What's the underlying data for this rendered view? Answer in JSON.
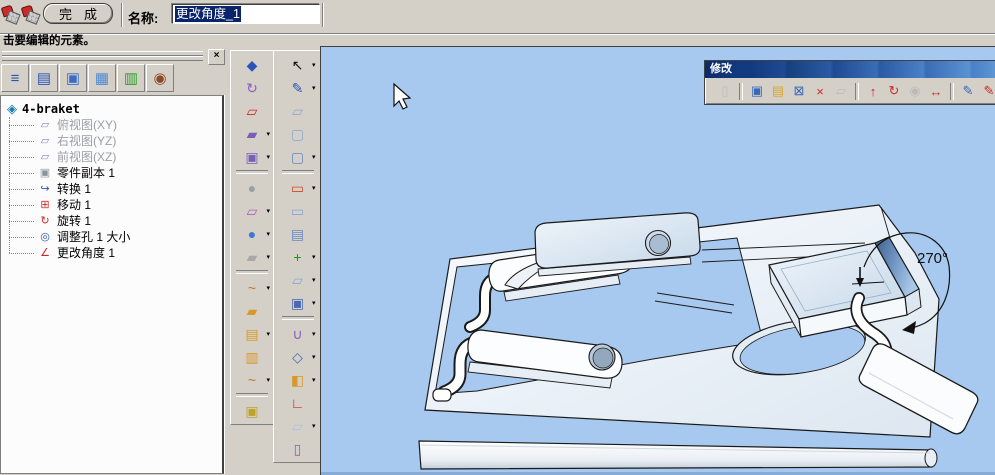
{
  "ui": {
    "dropdown_glyph": "▾",
    "window_bg": "#d4d0c8",
    "viewport_bg": "#a7c9ef",
    "selection_color": "#0a246a",
    "titlebar_blue": "#0a2a6a"
  },
  "top_toolbar": {
    "hammer_icons": [
      {
        "name": "hammer-tool-icon"
      },
      {
        "name": "hammer-tool-alt-icon"
      }
    ],
    "finish_label": "完成",
    "name_label": "名称:",
    "name_value": "更改角度_1"
  },
  "status_bar": {
    "text": "击要编辑的元素。"
  },
  "scene_browser": {
    "close_glyph": "×",
    "toolbar_icons": [
      {
        "name": "design-tree-icon",
        "glyph": "≡",
        "color": "#2a55b8"
      },
      {
        "name": "catalog-books-icon",
        "glyph": "▤",
        "color": "#2a55b8"
      },
      {
        "name": "assembly-parts-icon",
        "glyph": "▣",
        "color": "#3a6cc4"
      },
      {
        "name": "layers-icon",
        "glyph": "▦",
        "color": "#4a8ad4"
      },
      {
        "name": "render-settings-icon",
        "glyph": "▥",
        "color": "#2aa02a"
      },
      {
        "name": "camera-view-icon",
        "glyph": "◉",
        "color": "#8a4a2a"
      }
    ],
    "tree": {
      "root": {
        "label": "4-braket",
        "icon_name": "part-root-icon",
        "icon_glyph": "◈",
        "icon_color": "#1a7ab0"
      },
      "items": [
        {
          "label": "俯视图(XY)",
          "gray": true,
          "icon_name": "view-plane-icon",
          "icon_glyph": "▱",
          "icon_color": "#7a8fc0"
        },
        {
          "label": "右视图(YZ)",
          "gray": true,
          "icon_name": "view-plane-icon",
          "icon_glyph": "▱",
          "icon_color": "#7a8fc0"
        },
        {
          "label": "前视图(XZ)",
          "gray": true,
          "icon_name": "view-plane-icon",
          "icon_glyph": "▱",
          "icon_color": "#7a8fc0"
        },
        {
          "label": "零件副本 1",
          "gray": false,
          "icon_name": "part-copy-icon",
          "icon_glyph": "▣",
          "icon_color": "#8a94a0"
        },
        {
          "label": "转换 1",
          "gray": false,
          "icon_name": "transform-icon",
          "icon_glyph": "↪",
          "icon_color": "#2a55b8"
        },
        {
          "label": "移动 1",
          "gray": false,
          "icon_name": "move-icon",
          "icon_glyph": "⊞",
          "icon_color": "#cc2a2a"
        },
        {
          "label": "旋转 1",
          "gray": false,
          "icon_name": "rotate-icon",
          "icon_glyph": "↻",
          "icon_color": "#cc2a2a"
        },
        {
          "label": "调整孔 1 大小",
          "gray": false,
          "icon_name": "resize-hole-icon",
          "icon_glyph": "◎",
          "icon_color": "#2a55b8"
        },
        {
          "label": "更改角度 1",
          "gray": false,
          "icon_name": "change-angle-icon",
          "icon_glyph": "∠",
          "icon_color": "#cc2a2a"
        }
      ]
    }
  },
  "tool_columns": {
    "col1": [
      {
        "name": "smart-render-icon",
        "glyph": "◆",
        "color": "#2a55b8"
      },
      {
        "name": "spiral-tool-icon",
        "glyph": "↻",
        "color": "#8a5fc0"
      },
      {
        "name": "red-plane-icon",
        "glyph": "▱",
        "color": "#cc2a2a"
      },
      {
        "name": "surface-tool-icon",
        "glyph": "▰",
        "color": "#7a5fb8",
        "dd": true
      },
      {
        "name": "surface-copy-icon",
        "glyph": "▣",
        "color": "#7a5fb8",
        "dd": true
      },
      {
        "sep": true
      },
      {
        "name": "sphere-tool-icon",
        "glyph": "●",
        "color": "#9aa0a8"
      },
      {
        "name": "section-plane-icon",
        "glyph": "▱",
        "color": "#b05fb0",
        "dd": true
      },
      {
        "name": "blue-sphere-icon",
        "glyph": "●",
        "color": "#3a7ad4",
        "dd": true
      },
      {
        "name": "gray-surface-icon",
        "glyph": "▰",
        "color": "#a8a8a8",
        "dd": true
      },
      {
        "sep": true
      },
      {
        "name": "curve-tool-icon",
        "glyph": "~",
        "color": "#c07a2a",
        "dd": true
      },
      {
        "name": "gold-surface-icon",
        "glyph": "▰",
        "color": "#d9982a"
      },
      {
        "name": "fold-surface-icon",
        "glyph": "▤",
        "color": "#d9982a",
        "dd": true
      },
      {
        "name": "bend-surface-icon",
        "glyph": "▥",
        "color": "#d9982a"
      },
      {
        "name": "curve-point-icon",
        "glyph": "~",
        "color": "#c07a2a",
        "dd": true
      },
      {
        "sep": true
      },
      {
        "name": "camera-part-icon",
        "glyph": "▣",
        "color": "#c0a22a"
      }
    ],
    "col2": [
      {
        "name": "select-cursor-icon",
        "glyph": "↖",
        "color": "#111111",
        "dd": true
      },
      {
        "name": "edit-sketch-icon",
        "glyph": "✎",
        "color": "#2a55b8",
        "dd": true
      },
      {
        "name": "plane-icon",
        "glyph": "▱",
        "color": "#8aa8d4"
      },
      {
        "name": "bend-shape-icon",
        "glyph": "▢",
        "color": "#8aa8d4"
      },
      {
        "name": "bend-shape-alt-icon",
        "glyph": "▢",
        "color": "#6a88c0",
        "dd": true
      },
      {
        "sep": true
      },
      {
        "name": "profile-sketch-icon",
        "glyph": "▭",
        "color": "#cc4a2a",
        "dd": true
      },
      {
        "name": "blank-plane-icon",
        "glyph": "▭",
        "color": "#8aa8d4"
      },
      {
        "name": "extrude-shape-icon",
        "glyph": "▤",
        "color": "#6a88c0"
      },
      {
        "name": "add-material-icon",
        "glyph": "+",
        "color": "#1a9a1a",
        "dd": true
      },
      {
        "name": "sheet-plane-icon",
        "glyph": "▱",
        "color": "#8aa8d4",
        "dd": true
      },
      {
        "name": "framed-plane-icon",
        "glyph": "▣",
        "color": "#4a6ab0",
        "dd": true
      },
      {
        "sep": true
      },
      {
        "name": "clamp-tool-icon",
        "glyph": "∪",
        "color": "#8a5fc0",
        "dd": true
      },
      {
        "name": "move-points-icon",
        "glyph": "◇",
        "color": "#4a6ab0",
        "dd": true
      },
      {
        "name": "mirror-tool-icon",
        "glyph": "◧",
        "color": "#d9982a",
        "dd": true
      },
      {
        "name": "axes-icon",
        "glyph": "∟",
        "color": "#cc2a2a"
      },
      {
        "name": "white-plane-icon",
        "glyph": "▱",
        "color": "#a8c4e0",
        "dd": true
      },
      {
        "name": "extrude-solid-icon",
        "glyph": "▯",
        "color": "#8a5fc0"
      }
    ]
  },
  "modify_toolbar": {
    "title": "修改",
    "icons": [
      {
        "name": "extrude-feature-icon",
        "glyph": "▯",
        "color": "#a8a89e",
        "disabled": true
      },
      {
        "sep": true
      },
      {
        "name": "edit-intellishape-icon",
        "glyph": "▣",
        "color": "#3a66b8"
      },
      {
        "name": "edit-sketch-icon",
        "glyph": "▤",
        "color": "#d9a62a"
      },
      {
        "name": "delete-feature-icon",
        "glyph": "⊠",
        "color": "#3a66b8"
      },
      {
        "name": "delete-shape-icon",
        "glyph": "×",
        "color": "#cc2a2a"
      },
      {
        "name": "suppress-feature-icon",
        "glyph": "▱",
        "color": "#a8a89e",
        "disabled": true
      },
      {
        "sep": true
      },
      {
        "name": "move-feature-icon",
        "glyph": "↑",
        "color": "#cc2a2a"
      },
      {
        "name": "rotate-feature-icon",
        "glyph": "↻",
        "color": "#cc2a2a"
      },
      {
        "name": "scale-feature-icon",
        "glyph": "◉",
        "color": "#a8a89e",
        "disabled": true
      },
      {
        "name": "stretch-feature-icon",
        "glyph": "↔",
        "color": "#cc2a2a"
      },
      {
        "sep": true
      },
      {
        "name": "edit-surface-icon",
        "glyph": "✎",
        "color": "#3a66b8"
      },
      {
        "name": "edit-surface-red-icon",
        "glyph": "✎",
        "color": "#cc2a2a"
      }
    ]
  },
  "viewport": {
    "angle_label": "270°"
  }
}
